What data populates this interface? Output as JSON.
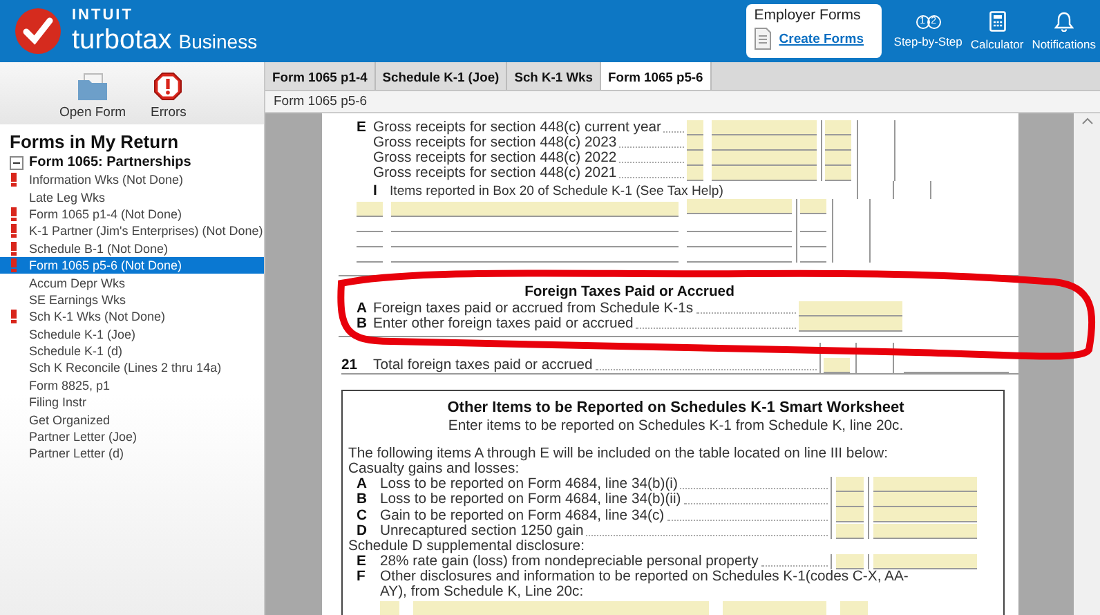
{
  "header": {
    "logo": {
      "brand": "INTUIT",
      "product": "turbotax",
      "edition": "Business"
    },
    "employer_forms": {
      "title": "Employer Forms",
      "link": "Create Forms"
    },
    "tools": [
      {
        "kind": "steps",
        "label": "Step-by-Step",
        "badges": [
          "1",
          "2"
        ]
      },
      {
        "kind": "calculator",
        "label": "Calculator"
      },
      {
        "kind": "bell",
        "label": "Notifications"
      }
    ]
  },
  "sidebar": {
    "toolbar": [
      {
        "kind": "folder",
        "label": "Open Form"
      },
      {
        "kind": "error",
        "label": "Errors"
      }
    ],
    "title": "Forms in My Return",
    "tree": {
      "label": "Form 1065:  Partnerships",
      "expanded": true,
      "children": [
        {
          "label": "Information Wks (Not Done)",
          "error": true,
          "selected": false
        },
        {
          "label": "Late Leg Wks",
          "error": false,
          "selected": false
        },
        {
          "label": "Form 1065 p1-4 (Not Done)",
          "error": true,
          "selected": false
        },
        {
          "label": "K-1 Partner (Jim's Enterprises) (Not Done)",
          "error": true,
          "selected": false
        },
        {
          "label": "Schedule B-1 (Not Done)",
          "error": true,
          "selected": false
        },
        {
          "label": "Form 1065 p5-6 (Not Done)",
          "error": true,
          "selected": true
        },
        {
          "label": "Accum Depr Wks",
          "error": false,
          "selected": false
        },
        {
          "label": "SE Earnings Wks",
          "error": false,
          "selected": false
        },
        {
          "label": "Sch K-1 Wks (Not Done)",
          "error": true,
          "selected": false
        },
        {
          "label": "Schedule K-1 (Joe)",
          "error": false,
          "selected": false
        },
        {
          "label": "Schedule K-1 (d)",
          "error": false,
          "selected": false
        },
        {
          "label": "Sch K Reconcile (Lines  2 thru 14a)",
          "error": false,
          "selected": false
        },
        {
          "label": "Form 8825, p1",
          "error": false,
          "selected": false
        },
        {
          "label": "Filing Instr",
          "error": false,
          "selected": false
        },
        {
          "label": "Get Organized",
          "error": false,
          "selected": false
        },
        {
          "label": "Partner Letter (Joe)",
          "error": false,
          "selected": false
        },
        {
          "label": "Partner Letter (d)",
          "error": false,
          "selected": false
        }
      ]
    }
  },
  "tabs": [
    {
      "label": "Form 1065 p1-4",
      "selected": false
    },
    {
      "label": "Schedule K-1 (Joe)",
      "selected": false
    },
    {
      "label": "Sch K-1 Wks",
      "selected": false
    },
    {
      "label": "Form 1065 p5-6",
      "selected": true
    }
  ],
  "breadcrumb": "Form 1065 p5-6",
  "document": {
    "upper_rows": [
      {
        "letter": "E",
        "text": "Gross receipts for section 448(c) current year"
      },
      {
        "letter": "",
        "text": "Gross receipts for section 448(c) 2023"
      },
      {
        "letter": "",
        "text": "Gross receipts for section 448(c) 2022"
      },
      {
        "letter": "",
        "text": "Gross receipts for section 448(c) 2021"
      }
    ],
    "box20": {
      "letter": "I",
      "text": "Items reported in Box 20 of Schedule K-1 (See Tax Help)"
    },
    "foreign_taxes": {
      "title": "Foreign Taxes Paid or Accrued",
      "lines": [
        {
          "letter": "A",
          "text": "Foreign taxes paid or accrued from Schedule K-1s"
        },
        {
          "letter": "B",
          "text": "Enter other foreign taxes paid or accrued"
        }
      ]
    },
    "line_21": {
      "number": "21",
      "text": "Total foreign taxes paid or accrued"
    },
    "worksheet": {
      "title": "Other Items to be Reported on Schedules K-1 Smart Worksheet",
      "subtitle": "Enter items to be reported on Schedules K-1 from Schedule K, line 20c.",
      "intro": "The following items A through E will be included on the table located on line III below:",
      "groups": [
        {
          "heading": "Casualty gains and losses:",
          "lines": [
            {
              "letter": "A",
              "text": "Loss to be reported on Form 4684, line 34(b)(i)",
              "kind": "amount"
            },
            {
              "letter": "B",
              "text": "Loss to be reported on Form 4684, line 34(b)(ii)",
              "kind": "amount"
            },
            {
              "letter": "C",
              "text": "Gain to be reported on Form 4684, line 34(c)",
              "kind": "amount"
            },
            {
              "letter": "D",
              "text": "Unrecaptured section 1250 gain",
              "kind": "amount"
            }
          ]
        },
        {
          "heading": "Schedule D supplemental disclosure:",
          "lines": [
            {
              "letter": "E",
              "text": "28% rate gain (loss) from nondepreciable personal property",
              "kind": "amount"
            },
            {
              "letter": "F",
              "text": "Other disclosures and information to be reported on Schedules K-1(codes C-X, AA-AY), from Schedule K, Line 20c:",
              "kind": "table"
            }
          ]
        }
      ]
    }
  }
}
